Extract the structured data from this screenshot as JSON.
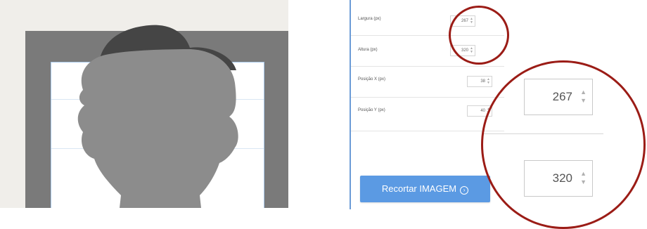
{
  "settings": {
    "width_label": "Largura (px)",
    "width_value": "267",
    "height_label": "Altura (px)",
    "height_value": "320",
    "pos_x_label": "Posição X (px)",
    "pos_x_value": "38",
    "pos_y_label": "Posição Y (px)",
    "pos_y_value": "40"
  },
  "crop_button": {
    "label": "Recortar IMAGEM",
    "icon": "arrow-circle-icon"
  },
  "zoom": {
    "width_value": "267",
    "height_value": "320"
  },
  "colors": {
    "button": "#5b9ae3",
    "annotation": "#9b1c16",
    "panel_border": "#6b9bd6"
  }
}
